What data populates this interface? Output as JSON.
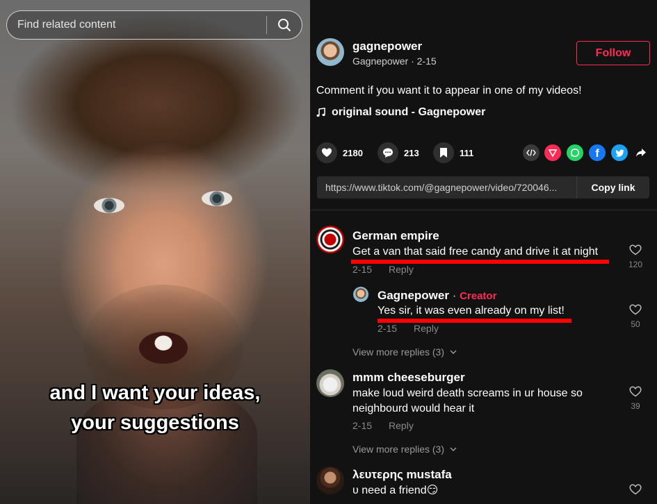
{
  "search": {
    "placeholder": "Find related content"
  },
  "video": {
    "caption_line1": "and I want your ideas,",
    "caption_line2": "your suggestions"
  },
  "author": {
    "username": "gagnepower",
    "display": "Gagnepower",
    "date": "2-15",
    "follow_label": "Follow"
  },
  "post": {
    "description": "Comment if you want it to appear in one of my videos!",
    "sound": "original sound - Gagnepower"
  },
  "stats": {
    "likes": "2180",
    "comments": "213",
    "saves": "111"
  },
  "link": {
    "url": "https://www.tiktok.com/@gagnepower/video/720046...",
    "copy_label": "Copy link"
  },
  "comments": [
    {
      "name": "German empire",
      "text": "Get a van that said free candy and drive it at night",
      "date": "2-15",
      "reply_label": "Reply",
      "likes": "120",
      "reply": {
        "name": "Gagnepower",
        "dot": " · ",
        "badge": "Creator",
        "text": "Yes sir, it was even already on my list!",
        "date": "2-15",
        "reply_label": "Reply",
        "likes": "50"
      },
      "view_more": "View more replies (3)"
    },
    {
      "name": "mmm cheeseburger",
      "text": "make loud weird death screams in ur house so neighbourd would hear it",
      "date": "2-15",
      "reply_label": "Reply",
      "likes": "39",
      "view_more": "View more replies (3)"
    },
    {
      "name": "λευτερης mustafa",
      "text": "υ need a friend😏"
    }
  ],
  "colors": {
    "accent": "#fe2c55",
    "highlight": "#ff0000",
    "background": "#121212"
  }
}
